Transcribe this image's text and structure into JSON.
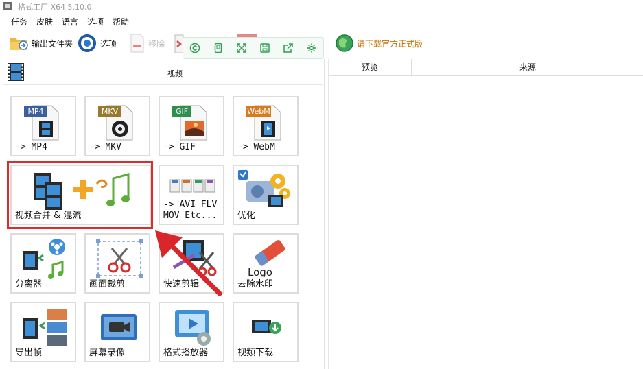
{
  "window": {
    "title": "格式工厂 X64 5.10.0"
  },
  "menu": [
    "任务",
    "皮肤",
    "语言",
    "选项",
    "帮助"
  ],
  "toolbar": {
    "output_folder": "输出文件夹",
    "options": "选项",
    "remove": "移除",
    "download_official": "请下载官方正式版"
  },
  "panel": {
    "title": "视频"
  },
  "tiles": [
    {
      "badge": "MP4",
      "label": "-> MP4"
    },
    {
      "badge": "MKV",
      "label": "-> MKV"
    },
    {
      "badge": "GIF",
      "label": "-> GIF"
    },
    {
      "badge": "WebM",
      "label": "-> WebM"
    },
    {
      "label": "视频合并 & 混流"
    },
    {
      "label_line1": "-> AVI FLV",
      "label_line2": "MOV Etc..."
    },
    {
      "label": "优化"
    },
    {
      "label": "分离器"
    },
    {
      "label": "画面裁剪"
    },
    {
      "label": "快速剪辑"
    },
    {
      "logo_text": "Logo",
      "label": "去除水印"
    },
    {
      "label": "导出帧"
    },
    {
      "label": "屏幕录像"
    },
    {
      "label": "格式播放器"
    },
    {
      "label": "视频下载"
    }
  ],
  "table": {
    "columns": [
      "预览",
      "来源"
    ]
  },
  "colors": {
    "highlight": "#e02b2b",
    "accent_green": "#2e9d4f",
    "download_link": "#d07a00"
  }
}
